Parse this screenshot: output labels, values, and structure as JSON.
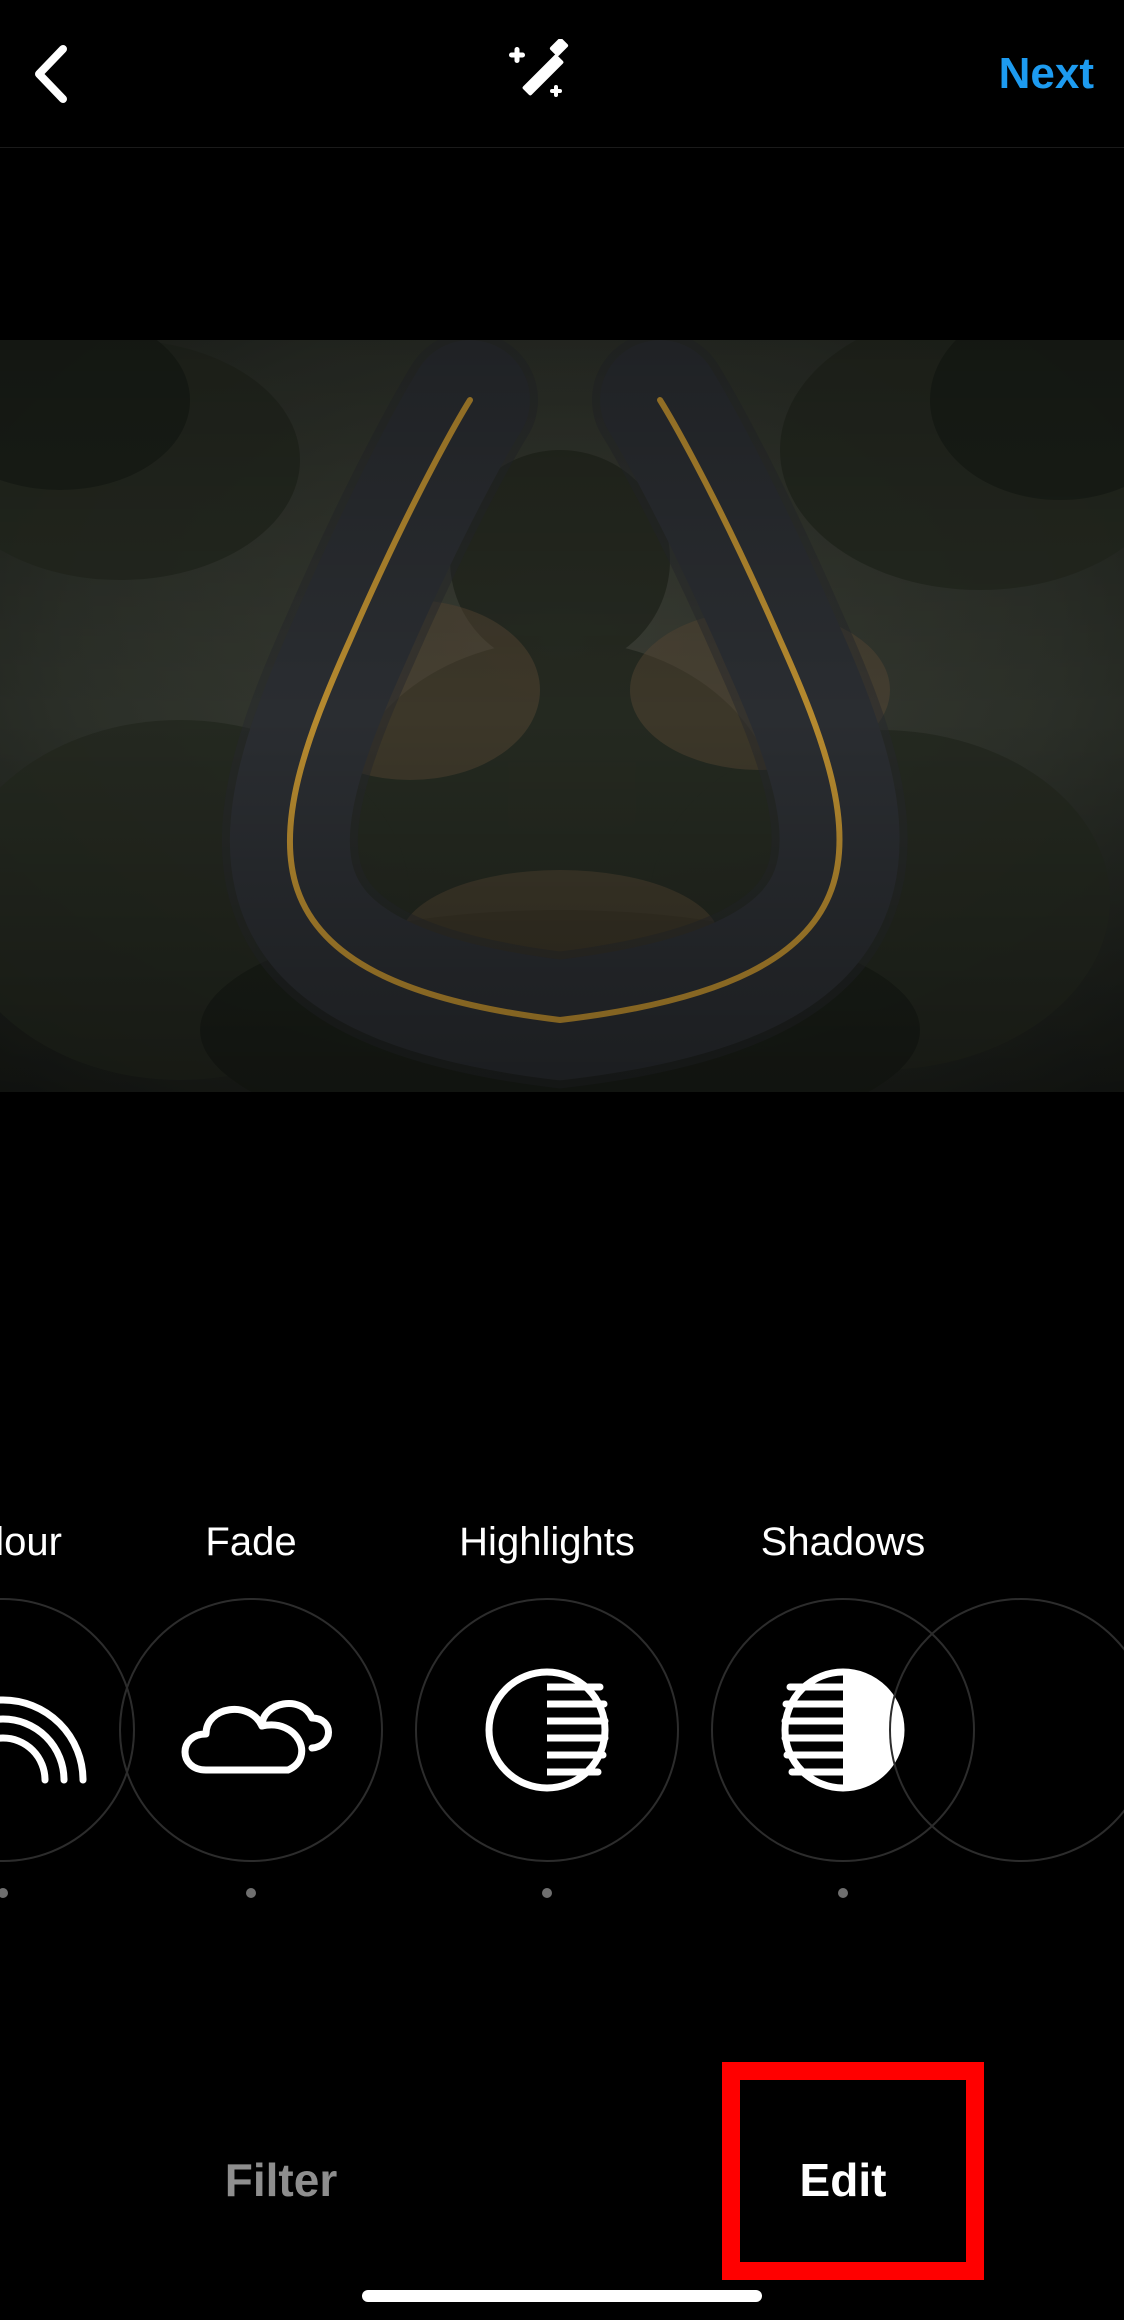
{
  "header": {
    "next_label": "Next"
  },
  "tools": [
    {
      "id": "colour",
      "label": "Colour",
      "icon": "rainbow-icon"
    },
    {
      "id": "fade",
      "label": "Fade",
      "icon": "clouds-icon"
    },
    {
      "id": "highlights",
      "label": "Highlights",
      "icon": "highlights-icon"
    },
    {
      "id": "shadows",
      "label": "Shadows",
      "icon": "shadows-icon"
    }
  ],
  "bottom_tabs": {
    "filter_label": "Filter",
    "edit_label": "Edit",
    "active": "edit"
  },
  "colors": {
    "accent": "#1d9bf0",
    "highlight": "#ff0000"
  }
}
